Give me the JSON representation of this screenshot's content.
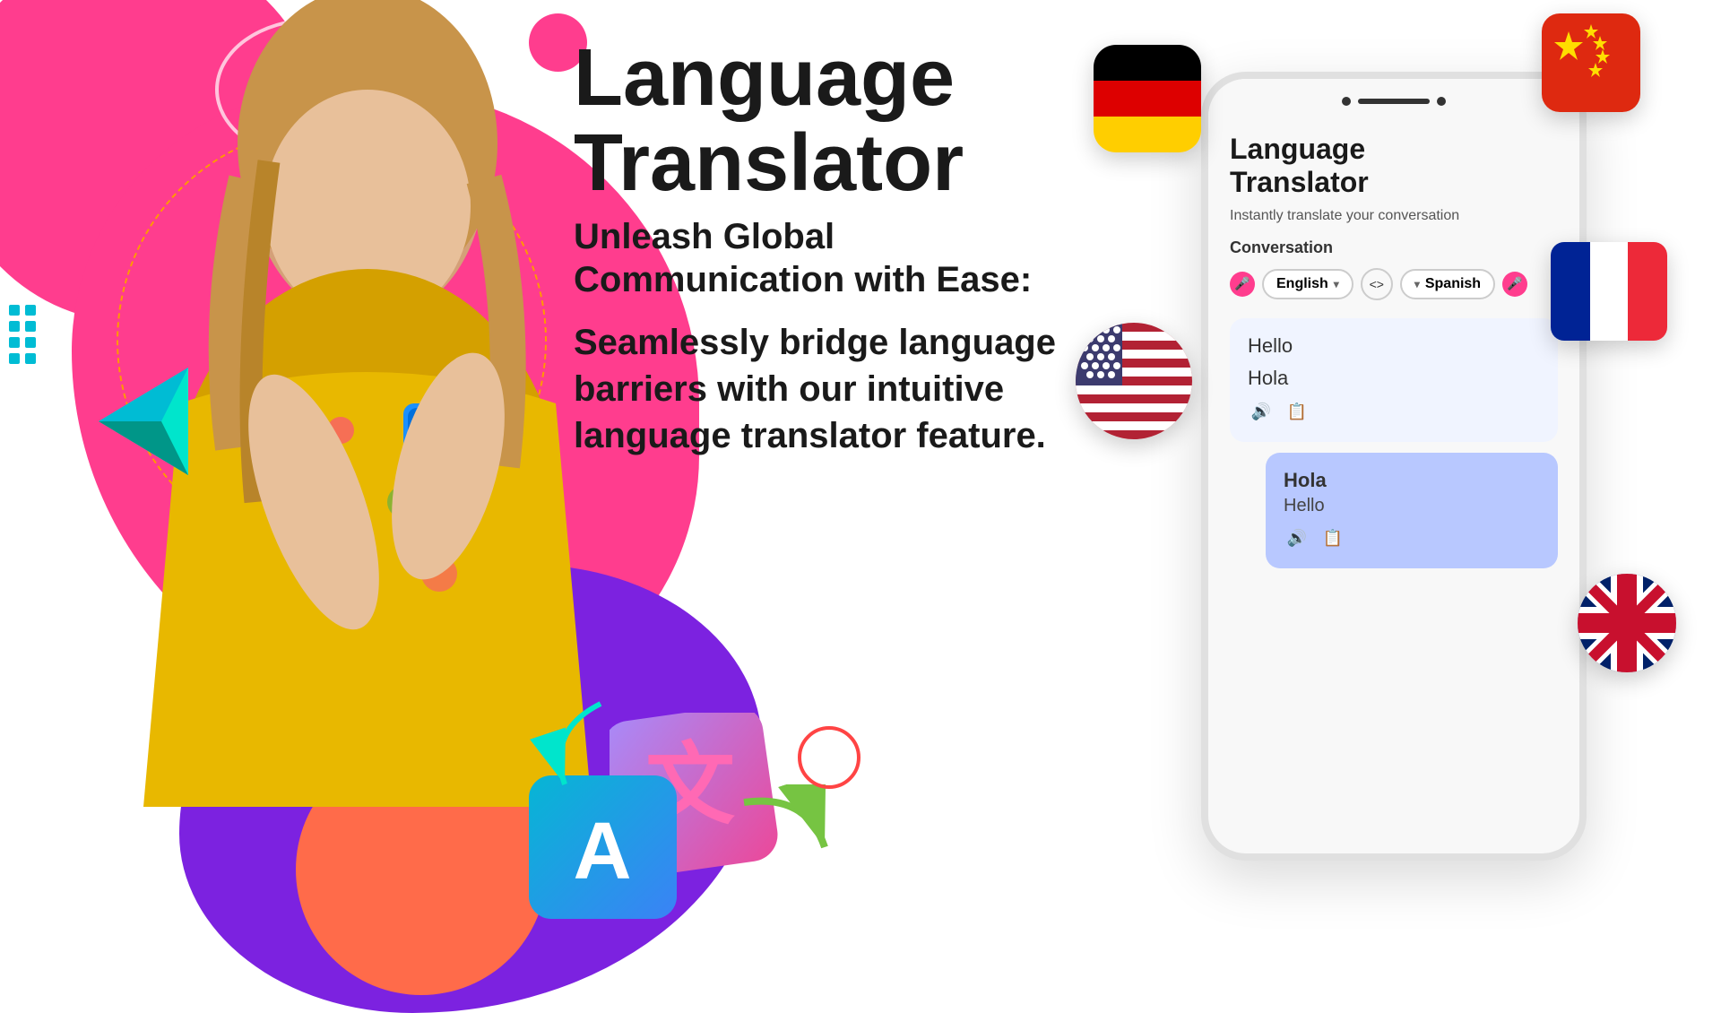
{
  "page": {
    "background_color": "#ffffff"
  },
  "title": {
    "line1": "Language",
    "line2": "Translator"
  },
  "tagline": {
    "headline": "Unleash Global Communication with Ease:",
    "body": "Seamlessly bridge language barriers with our intuitive language translator feature."
  },
  "phone": {
    "app_title_line1": "Language",
    "app_title_line2": "Translator",
    "subtitle": "Instantly translate your conversation",
    "section_label": "Conversation",
    "source_lang": "English",
    "target_lang": "Spanish",
    "translation_1_source": "Hello",
    "translation_1_target": "Hola",
    "translation_2_source": "Hello",
    "translation_2_target": "Hola"
  },
  "flags": {
    "german": "German flag",
    "chinese": "Chinese flag",
    "french": "French flag",
    "usa": "USA flag",
    "uk": "UK flag"
  },
  "icons": {
    "mic": "🎤",
    "swap": "<>",
    "speaker": "🔊",
    "copy": "📋",
    "chevron_down": "▾"
  },
  "decorations": {
    "chat_symbol_1": "文",
    "chat_symbol_2": "A"
  }
}
